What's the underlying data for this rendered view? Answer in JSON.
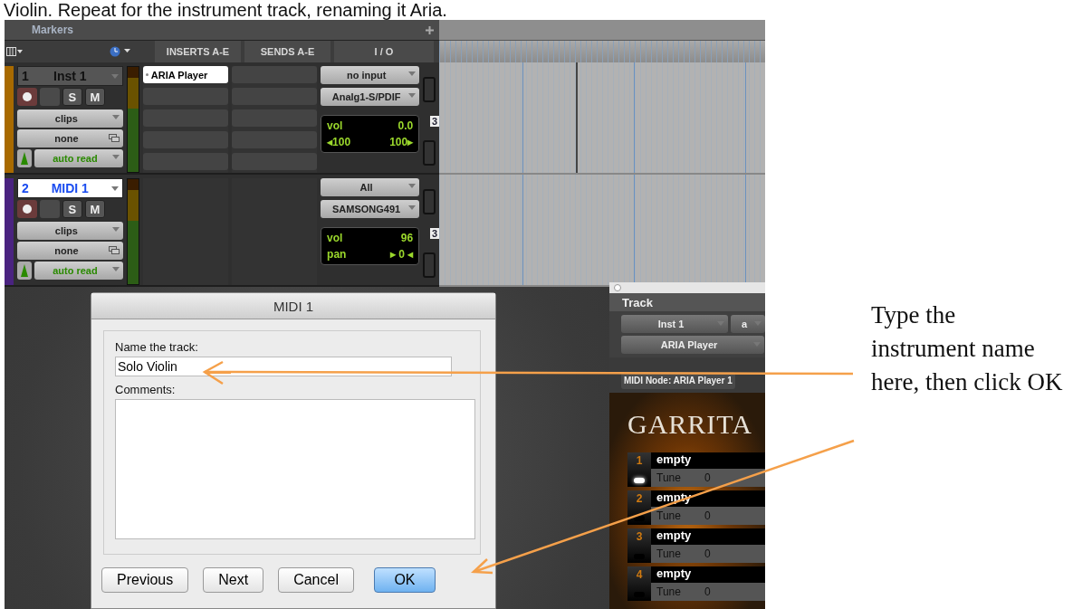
{
  "heading": "Violin. Repeat for the instrument track, renaming it Aria.",
  "mix": {
    "markers_label": "Markers",
    "columns": [
      "INSERTS A-E",
      "SENDS A-E",
      "I / O"
    ],
    "tracks": [
      {
        "number": "1",
        "name": "Inst 1",
        "selected": false,
        "color": "#a86a00",
        "solo": "S",
        "mute": "M",
        "clips": "clips",
        "group": "none",
        "automation": "auto read",
        "inserts": [
          {
            "kind": "plugin",
            "name": "ARIA Player"
          },
          {
            "kind": "empty"
          },
          {
            "kind": "empty"
          },
          {
            "kind": "empty"
          },
          {
            "kind": "empty"
          }
        ],
        "sends": [
          {
            "kind": "empty"
          },
          {
            "kind": "empty"
          },
          {
            "kind": "empty"
          },
          {
            "kind": "empty"
          },
          {
            "kind": "empty"
          }
        ],
        "input": "no input",
        "output": "Analg1-S/PDIF",
        "readouts": [
          [
            "vol",
            "0.0"
          ],
          [
            "◂100",
            "100▸"
          ]
        ],
        "height_label": "3",
        "playhead": true
      },
      {
        "number": "2",
        "name": "MIDI 1",
        "selected": true,
        "color": "#4a2380",
        "solo": "S",
        "mute": "M",
        "clips": "clips",
        "group": "none",
        "automation": "auto read",
        "input": "All",
        "output": "SAMSONG491",
        "readouts": [
          [
            "vol",
            "96"
          ],
          [
            "pan",
            "▸ 0 ◂"
          ]
        ],
        "height_label": "3",
        "playhead": false
      }
    ]
  },
  "dialog": {
    "title": "MIDI 1",
    "name_label": "Name the track:",
    "name_value": "Solo Violin",
    "comments_label": "Comments:",
    "buttons": [
      {
        "label": "Previous",
        "default": false
      },
      {
        "label": "Next",
        "default": false
      },
      {
        "label": "Cancel",
        "default": false
      },
      {
        "label": "OK",
        "default": true
      }
    ]
  },
  "plugin": {
    "section": "Track",
    "track_select": "Inst 1",
    "insert_select": "a",
    "plugin_select": "ARIA Player",
    "node": "MIDI Node: ARIA Player 1",
    "brand": "GARRITA",
    "slots": [
      {
        "number": "1",
        "name": "empty",
        "param": "Tune",
        "value": "0",
        "active": true
      },
      {
        "number": "2",
        "name": "empty",
        "param": "Tune",
        "value": "0",
        "active": false
      },
      {
        "number": "3",
        "name": "empty",
        "param": "Tune",
        "value": "0",
        "active": false
      },
      {
        "number": "4",
        "name": "empty",
        "param": "Tune",
        "value": "0",
        "active": false
      }
    ]
  },
  "annotation": "Type the instrument name here, then click OK"
}
